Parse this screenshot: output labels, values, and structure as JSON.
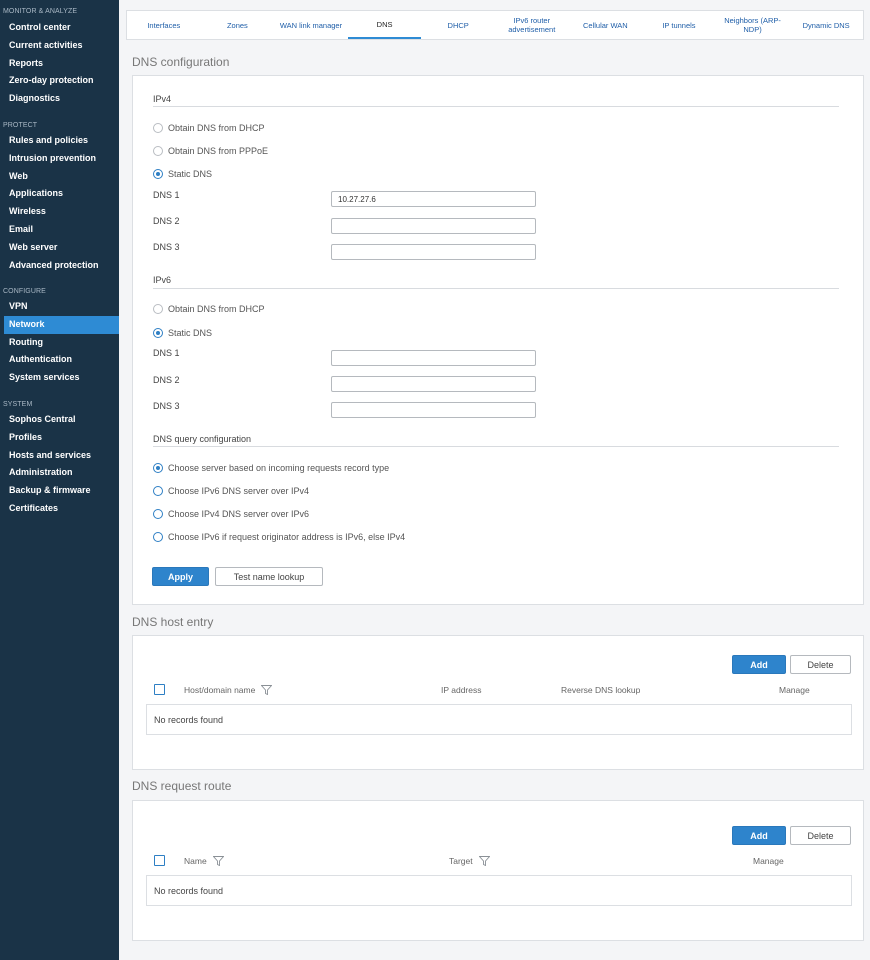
{
  "sidebar": {
    "sections": [
      {
        "title": "MONITOR & ANALYZE",
        "items": [
          "Control center",
          "Current activities",
          "Reports",
          "Zero-day protection",
          "Diagnostics"
        ]
      },
      {
        "title": "PROTECT",
        "items": [
          "Rules and policies",
          "Intrusion prevention",
          "Web",
          "Applications",
          "Wireless",
          "Email",
          "Web server",
          "Advanced protection"
        ]
      },
      {
        "title": "CONFIGURE",
        "items": [
          "VPN",
          "Network",
          "Routing",
          "Authentication",
          "System services"
        ]
      },
      {
        "title": "SYSTEM",
        "items": [
          "Sophos Central",
          "Profiles",
          "Hosts and services",
          "Administration",
          "Backup & firmware",
          "Certificates"
        ]
      }
    ],
    "active_item": "Network"
  },
  "tabs": [
    "Interfaces",
    "Zones",
    "WAN link manager",
    "DNS",
    "DHCP",
    "IPv6 router advertisement",
    "Cellular WAN",
    "IP tunnels",
    "Neighbors (ARP-NDP)",
    "Dynamic DNS"
  ],
  "active_tab": "DNS",
  "dns_config": {
    "title": "DNS configuration",
    "ipv4": {
      "label": "IPv4",
      "options": [
        "Obtain DNS from DHCP",
        "Obtain DNS from PPPoE",
        "Static DNS"
      ],
      "selected": "Static DNS",
      "fields": [
        {
          "label": "DNS 1",
          "value": "10.27.27.6"
        },
        {
          "label": "DNS 2",
          "value": ""
        },
        {
          "label": "DNS 3",
          "value": ""
        }
      ]
    },
    "ipv6": {
      "label": "IPv6",
      "options": [
        "Obtain DNS from DHCP",
        "Static DNS"
      ],
      "selected": "Static DNS",
      "fields": [
        {
          "label": "DNS 1",
          "value": ""
        },
        {
          "label": "DNS 2",
          "value": ""
        },
        {
          "label": "DNS 3",
          "value": ""
        }
      ]
    },
    "query": {
      "label": "DNS query configuration",
      "options": [
        "Choose server based on incoming requests record type",
        "Choose IPv6 DNS server over IPv4",
        "Choose IPv4 DNS server over IPv6",
        "Choose IPv6 if request originator address is IPv6, else IPv4"
      ],
      "selected": "Choose server based on incoming requests record type"
    },
    "apply_label": "Apply",
    "test_label": "Test name lookup"
  },
  "host_entry": {
    "title": "DNS host entry",
    "add_label": "Add",
    "delete_label": "Delete",
    "columns": [
      "Host/domain name",
      "IP address",
      "Reverse DNS lookup",
      "Manage"
    ],
    "empty": "No records found"
  },
  "request_route": {
    "title": "DNS request route",
    "add_label": "Add",
    "delete_label": "Delete",
    "columns": [
      "Name",
      "Target",
      "Manage"
    ],
    "empty": "No records found"
  },
  "colors": {
    "sidebar_bg": "#1a3347",
    "accent": "#2e84cc",
    "link": "#1f5ea8"
  },
  "icons": [
    "funnel-filter-icon"
  ]
}
